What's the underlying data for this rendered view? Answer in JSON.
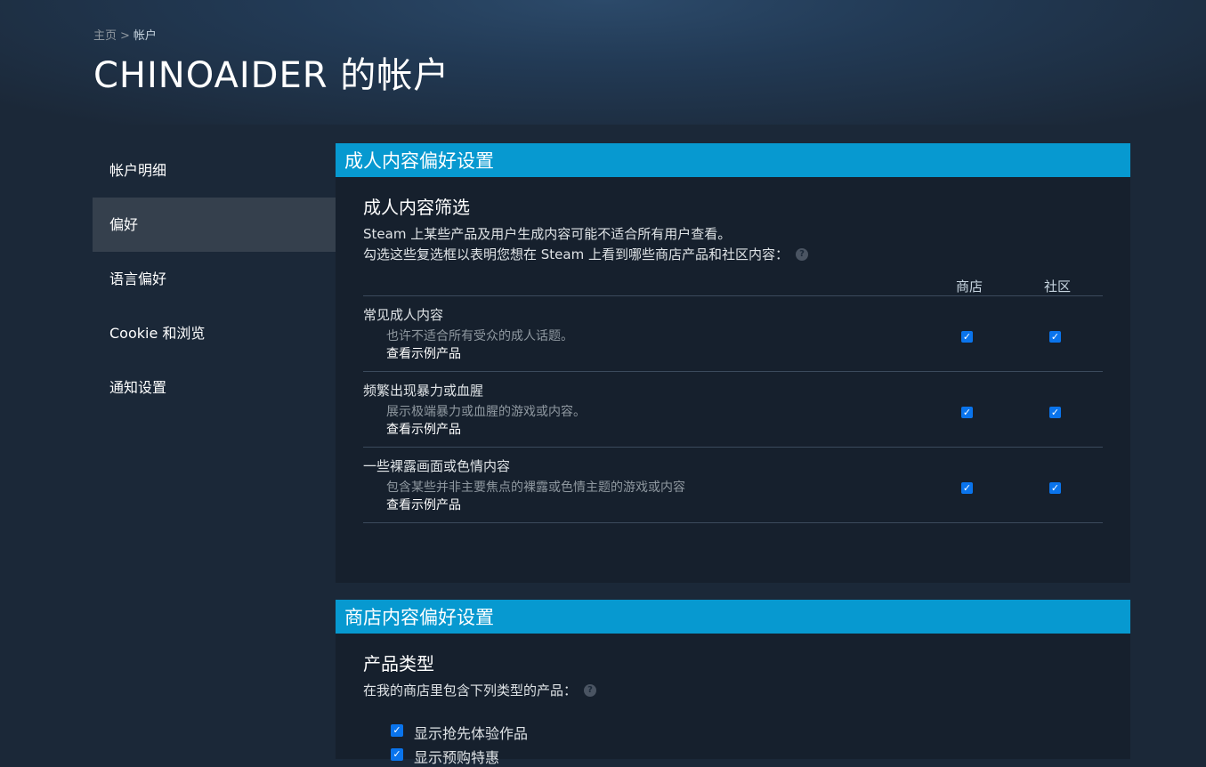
{
  "breadcrumb": {
    "home": "主页",
    "separator": ">",
    "current": "帐户"
  },
  "page_title": "CHINOAIDER 的帐户",
  "sidebar": {
    "items": [
      {
        "label": "帐户明细",
        "active": false
      },
      {
        "label": "偏好",
        "active": true
      },
      {
        "label": "语言偏好",
        "active": false
      },
      {
        "label": "Cookie 和浏览",
        "active": false
      },
      {
        "label": "通知设置",
        "active": false
      }
    ]
  },
  "adult_panel": {
    "header": "成人内容偏好设置",
    "section_title": "成人内容筛选",
    "desc_line1": "Steam 上某些产品及用户生成内容可能不适合所有用户查看。",
    "desc_line2": "勾选这些复选框以表明您想在 Steam 上看到哪些商店产品和社区内容：",
    "help_icon": "?",
    "col_store": "商店",
    "col_community": "社区",
    "rows": [
      {
        "title": "常见成人内容",
        "desc": "也许不适合所有受众的成人话题。",
        "link": "查看示例产品",
        "store_checked": true,
        "community_checked": true
      },
      {
        "title": "频繁出现暴力或血腥",
        "desc": "展示极端暴力或血腥的游戏或内容。",
        "link": "查看示例产品",
        "store_checked": true,
        "community_checked": true
      },
      {
        "title": "一些裸露画面或色情内容",
        "desc": "包含某些并非主要焦点的裸露或色情主题的游戏或内容",
        "link": "查看示例产品",
        "store_checked": true,
        "community_checked": true
      }
    ]
  },
  "store_panel": {
    "header": "商店内容偏好设置",
    "section_title": "产品类型",
    "desc": "在我的商店里包含下列类型的产品：",
    "help_icon": "?",
    "options": [
      {
        "label": "显示抢先体验作品",
        "checked": true
      },
      {
        "label": "显示预购特惠",
        "checked": true
      }
    ]
  },
  "colors": {
    "accent": "#0799d0",
    "checkbox": "#0a74ec",
    "background": "#1b2838",
    "panel": "#16202d"
  },
  "icons": {
    "checkbox": "check-icon",
    "help": "help-icon"
  }
}
